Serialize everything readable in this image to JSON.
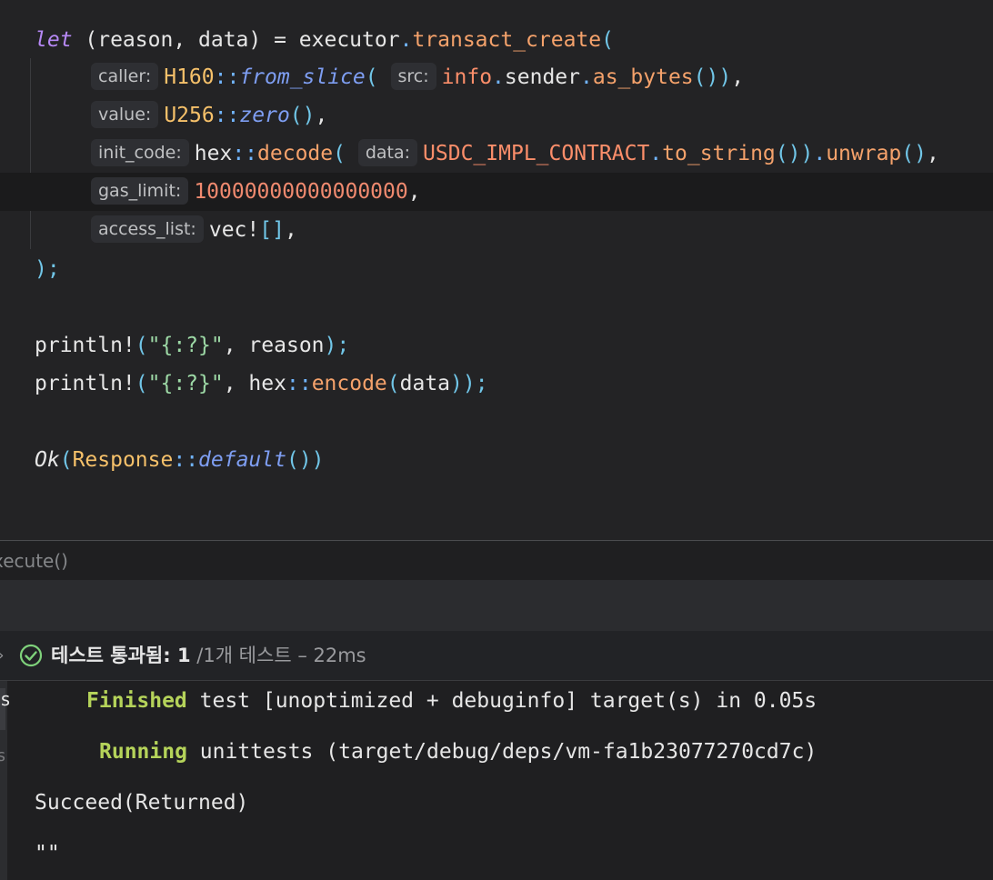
{
  "editor": {
    "lines": [
      [
        {
          "t": "let",
          "c": "kw"
        },
        {
          "t": " (reason, data) = executor",
          "c": "id"
        },
        {
          "t": ".",
          "c": "op"
        },
        {
          "t": "transact_create",
          "c": "fn"
        },
        {
          "t": "(",
          "c": "pn"
        }
      ],
      [
        {
          "hint": "caller:"
        },
        {
          "t": "H160",
          "c": "ty"
        },
        {
          "t": "::",
          "c": "op"
        },
        {
          "t": "from_slice",
          "c": "it"
        },
        {
          "t": "(",
          "c": "pn"
        },
        {
          "t": " ",
          "c": "id"
        },
        {
          "hint": "src:"
        },
        {
          "t": "info",
          "c": "pm"
        },
        {
          "t": ".",
          "c": "op"
        },
        {
          "t": "sender",
          "c": "id"
        },
        {
          "t": ".",
          "c": "op"
        },
        {
          "t": "as_bytes",
          "c": "fn"
        },
        {
          "t": "())",
          "c": "pn"
        },
        {
          "t": ",",
          "c": "id"
        }
      ],
      [
        {
          "hint": "value:"
        },
        {
          "t": "U256",
          "c": "ty"
        },
        {
          "t": "::",
          "c": "op"
        },
        {
          "t": "zero",
          "c": "it"
        },
        {
          "t": "()",
          "c": "pn"
        },
        {
          "t": ",",
          "c": "id"
        }
      ],
      [
        {
          "hint": "init_code:"
        },
        {
          "t": "hex",
          "c": "id"
        },
        {
          "t": "::",
          "c": "op"
        },
        {
          "t": "decode",
          "c": "fn"
        },
        {
          "t": "(",
          "c": "pn"
        },
        {
          "t": " ",
          "c": "id"
        },
        {
          "hint": "data:"
        },
        {
          "t": "USDC_IMPL_CONTRACT",
          "c": "pm"
        },
        {
          "t": ".",
          "c": "op"
        },
        {
          "t": "to_string",
          "c": "fn"
        },
        {
          "t": "())",
          "c": "pn"
        },
        {
          "t": ".",
          "c": "op"
        },
        {
          "t": "unwrap",
          "c": "fn"
        },
        {
          "t": "()",
          "c": "pn"
        },
        {
          "t": ",",
          "c": "id"
        }
      ],
      [
        {
          "hint": "gas_limit:"
        },
        {
          "t": "10000000000000000",
          "c": "num"
        },
        {
          "t": ",",
          "c": "id"
        }
      ],
      [
        {
          "hint": "access_list:"
        },
        {
          "t": "vec!",
          "c": "mac"
        },
        {
          "t": "[]",
          "c": "pn"
        },
        {
          "t": ",",
          "c": "id"
        }
      ],
      [
        {
          "t": ");",
          "c": "pn"
        }
      ],
      [],
      [
        {
          "t": "println!",
          "c": "mac"
        },
        {
          "t": "(",
          "c": "pn"
        },
        {
          "t": "\"{:?}\"",
          "c": "str"
        },
        {
          "t": ", reason",
          "c": "id"
        },
        {
          "t": ");",
          "c": "pn"
        }
      ],
      [
        {
          "t": "println!",
          "c": "mac"
        },
        {
          "t": "(",
          "c": "pn"
        },
        {
          "t": "\"{:?}\"",
          "c": "str"
        },
        {
          "t": ", hex",
          "c": "id"
        },
        {
          "t": "::",
          "c": "op"
        },
        {
          "t": "encode",
          "c": "fn"
        },
        {
          "t": "(",
          "c": "pn"
        },
        {
          "t": "data",
          "c": "id"
        },
        {
          "t": "));",
          "c": "pn"
        }
      ],
      [],
      [
        {
          "t": "Ok",
          "c": "kw2"
        },
        {
          "t": "(",
          "c": "pn"
        },
        {
          "t": "Response",
          "c": "ty"
        },
        {
          "t": "::",
          "c": "op"
        },
        {
          "t": "default",
          "c": "it"
        },
        {
          "t": "())",
          "c": "pn"
        }
      ]
    ]
  },
  "breadcrumb": "xecute()",
  "test_status": {
    "label": "테스트 통과됨: ",
    "passed": "1",
    "rest": " /1개 테스트 – 22ms"
  },
  "output": {
    "finished_word": "Finished",
    "finished_rest": " test [unoptimized + debuginfo] target(s) in 0.05s",
    "running_word": "Running",
    "running_rest": " unittests (target/debug/deps/vm-fa1b23077270cd7c)",
    "result": "Succeed(Returned)",
    "empty_str": "\"\""
  },
  "gutter": {
    "g1": "s",
    "g2": "s"
  },
  "colors": {
    "accent_green": "#b5d35a",
    "keyword": "#b688f5",
    "function": "#f5a26b",
    "type": "#f6c16a",
    "number": "#f08a6f"
  },
  "icons": {
    "status": "check-circle-icon"
  }
}
